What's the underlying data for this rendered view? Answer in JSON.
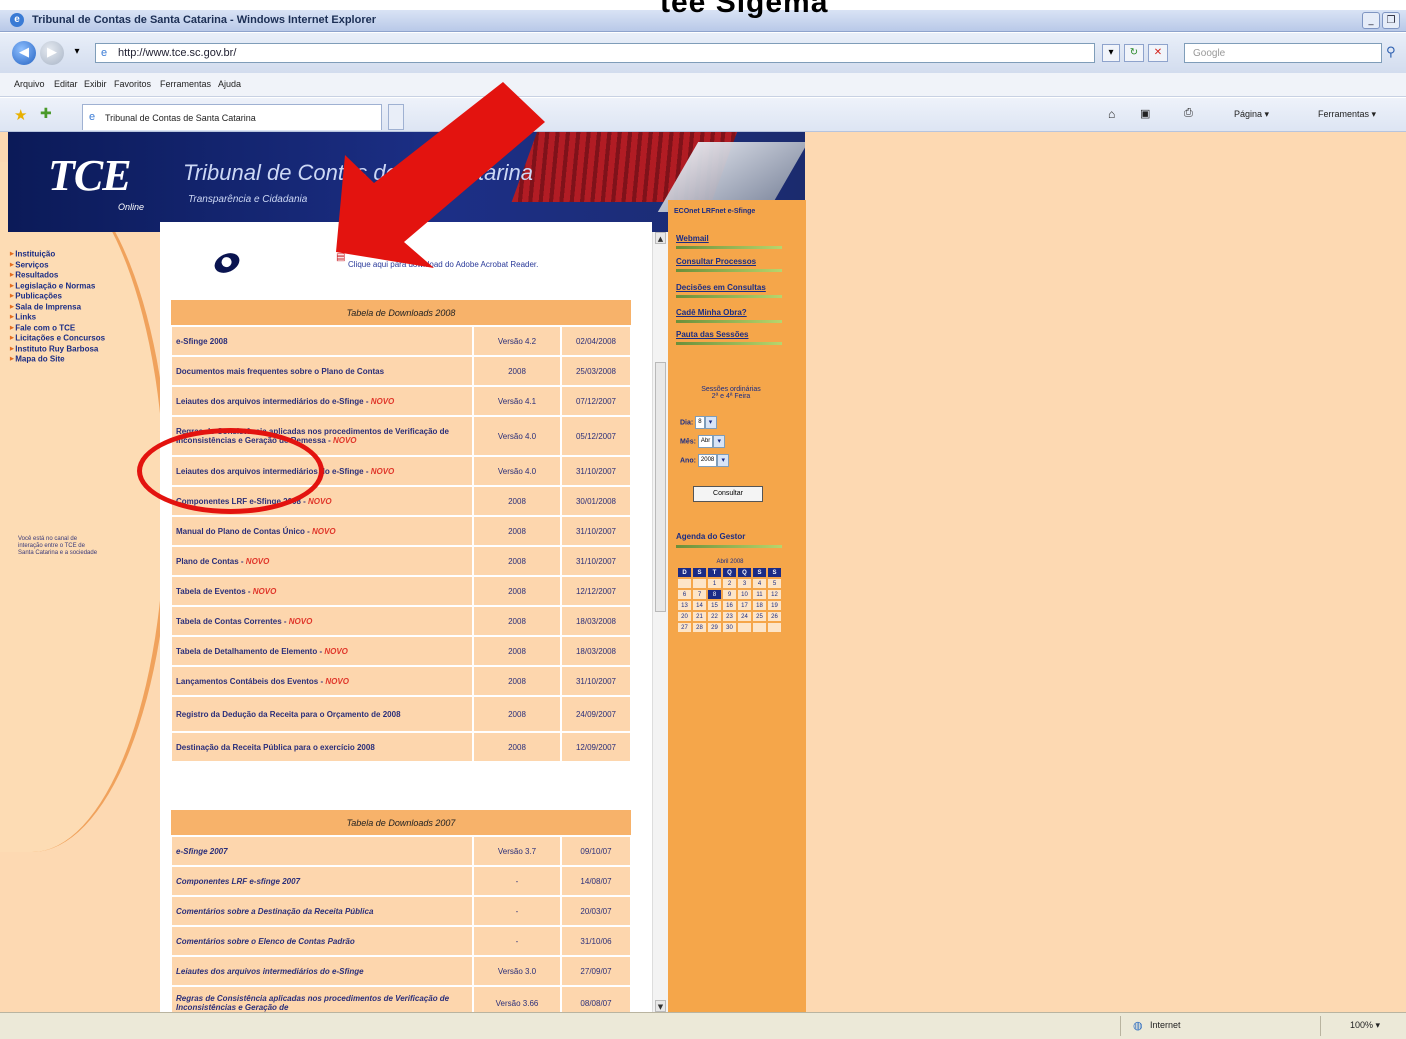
{
  "slide": {
    "heading_fragment": "tee Sigema"
  },
  "window": {
    "title": "Tribunal de Contas de Santa Catarina - Windows Internet Explorer",
    "minimize": "_",
    "restore": "❐"
  },
  "address": {
    "url": "http://www.tce.sc.gov.br/",
    "search_placeholder": "Google"
  },
  "menu": [
    "Arquivo",
    "Editar",
    "Exibir",
    "Favoritos",
    "Ferramentas",
    "Ajuda"
  ],
  "tab": {
    "label": "Tribunal de Contas de Santa Catarina"
  },
  "commands": {
    "page": "Página",
    "tools": "Ferramentas"
  },
  "site": {
    "logo": "TCE",
    "logo_sub": "Online",
    "title": "Tribunal de Contas de Santa Catarina",
    "title_visible": "Tribunal de Contas de",
    "title_end": "tarina",
    "tagline": "Transparência e Cidadania"
  },
  "left_nav": [
    "Instituição",
    "Serviços",
    "Resultados",
    "Legislação e Normas",
    "Publicações",
    "Sala de Imprensa",
    "Links",
    "Fale com o TCE",
    "Licitações e Concursos",
    "Instituto Ruy Barbosa",
    "Mapa do Site"
  ],
  "left_note": "Você está no canal de interação entre o TCE de Santa Catarina e a sociedade",
  "acrobat_link": "Clique aqui para download do Adobe Acrobat Reader.",
  "table2008": {
    "title": "Tabela de Downloads 2008",
    "rows": [
      {
        "name": "e-Sfinge 2008",
        "novo": "",
        "version": "Versão 4.2",
        "date": "02/04/2008"
      },
      {
        "name": "Documentos mais frequentes sobre o Plano de Contas",
        "novo": "",
        "version": "2008",
        "date": "25/03/2008"
      },
      {
        "name": "Leiautes dos arquivos intermediários do e-Sfinge - ",
        "novo": "NOVO",
        "version": "Versão 4.1",
        "date": "07/12/2007"
      },
      {
        "name": "Regras de Consistência aplicadas nos procedimentos de Verificação de Inconsistências e Geração de Remessa - ",
        "novo": "NOVO",
        "version": "Versão 4.0",
        "date": "05/12/2007"
      },
      {
        "name": "Leiautes dos arquivos intermediários do e-Sfinge - ",
        "novo": "NOVO",
        "version": "Versão 4.0",
        "date": "31/10/2007"
      },
      {
        "name": "Componentes LRF e-Sfinge 2008 - ",
        "novo": "NOVO",
        "version": "2008",
        "date": "30/01/2008"
      },
      {
        "name": "Manual do Plano de Contas Único - ",
        "novo": "NOVO",
        "version": "2008",
        "date": "31/10/2007"
      },
      {
        "name": "Plano de Contas - ",
        "novo": "NOVO",
        "version": "2008",
        "date": "31/10/2007"
      },
      {
        "name": "Tabela de Eventos - ",
        "novo": "NOVO",
        "version": "2008",
        "date": "12/12/2007"
      },
      {
        "name": "Tabela de Contas Correntes - ",
        "novo": "NOVO",
        "version": "2008",
        "date": "18/03/2008"
      },
      {
        "name": "Tabela de Detalhamento de Elemento - ",
        "novo": "NOVO",
        "version": "2008",
        "date": "18/03/2008"
      },
      {
        "name": "Lançamentos Contábeis dos Eventos - ",
        "novo": "NOVO",
        "version": "2008",
        "date": "31/10/2007"
      },
      {
        "name": "Registro da Dedução da Receita para o Orçamento de 2008",
        "novo": "",
        "version": "2008",
        "date": "24/09/2007"
      },
      {
        "name": "Destinação da Receita Pública para o exercício 2008",
        "novo": "",
        "version": "2008",
        "date": "12/09/2007"
      }
    ]
  },
  "table2007": {
    "title": "Tabela de Downloads 2007",
    "rows": [
      {
        "name": "e-Sfinge 2007",
        "version": "Versão 3.7",
        "date": "09/10/07"
      },
      {
        "name": "Componentes LRF e-sfinge 2007",
        "version": "-",
        "date": "14/08/07"
      },
      {
        "name": "Comentários sobre a Destinação da Receita Pública",
        "version": "-",
        "date": "20/03/07"
      },
      {
        "name": "Comentários sobre o Elenco de Contas Padrão",
        "version": "-",
        "date": "31/10/06"
      },
      {
        "name": "Leiautes dos arquivos intermediários do e-Sfinge",
        "version": "Versão 3.0",
        "date": "27/09/07"
      },
      {
        "name": "Regras de Consistência aplicadas nos procedimentos de Verificação de Inconsistências e Geração de",
        "version": "Versão 3.66",
        "date": "08/08/07"
      }
    ]
  },
  "right": {
    "top_links": "ECOnet  LRFnet  e-Sfinge",
    "links": [
      "Webmail",
      "Consultar Processos",
      "Decisões em Consultas",
      "Cadê Minha Obra?",
      "Pauta das Sessões"
    ],
    "sessions_line1": "Sessões ordinárias",
    "sessions_line2": "2ª e 4ª Feira",
    "dia_label": "Dia:",
    "dia_value": "8",
    "mes_label": "Mês:",
    "mes_value": "Abr",
    "ano_label": "Ano:",
    "ano_value": "2008",
    "consultar": "Consultar",
    "agenda": "Agenda do Gestor",
    "cal_title": "Abril 2008",
    "cal_headers": [
      "D",
      "S",
      "T",
      "Q",
      "Q",
      "S",
      "S"
    ],
    "cal_days": [
      "",
      "",
      "1",
      "2",
      "3",
      "4",
      "5",
      "6",
      "7",
      "8",
      "9",
      "10",
      "11",
      "12",
      "13",
      "14",
      "15",
      "16",
      "17",
      "18",
      "19",
      "20",
      "21",
      "22",
      "23",
      "24",
      "25",
      "26",
      "27",
      "28",
      "29",
      "30",
      "",
      "",
      ""
    ],
    "cal_today": "8"
  },
  "status": {
    "zone": "Internet",
    "zoom": "100%"
  },
  "colors": {
    "annotation_red": "#e3130f",
    "header_blue": "#1c2f86",
    "orange": "#f5a64a"
  }
}
